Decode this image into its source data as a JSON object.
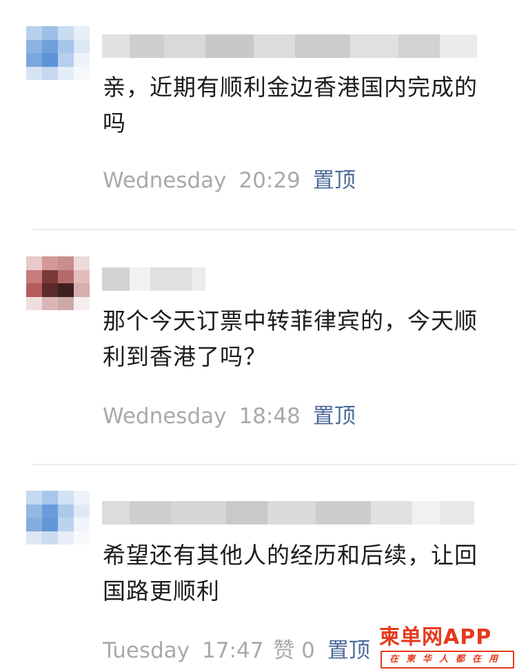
{
  "comments": [
    {
      "text": "亲，近期有顺利金边香港国内完成的吗",
      "day": "Wednesday",
      "time": "20:29",
      "likes": "",
      "pin": "置顶"
    },
    {
      "text": "那个今天订票中转菲律宾的，今天顺利到香港了吗？",
      "day": "Wednesday",
      "time": "18:48",
      "likes": "",
      "pin": "置顶"
    },
    {
      "text": "希望还有其他人的经历和后续，让回国路更顺利",
      "day": "Tuesday",
      "time": "17:47",
      "likes": "赞 0",
      "pin": "置顶"
    }
  ],
  "watermark": {
    "title": "柬单网APP",
    "subtitle": "在柬华人都在用"
  },
  "colors": {
    "text": "#1c1c1c",
    "meta": "#a9a9a9",
    "pin": "#4c6a9a",
    "watermark": "#e43a1c"
  }
}
